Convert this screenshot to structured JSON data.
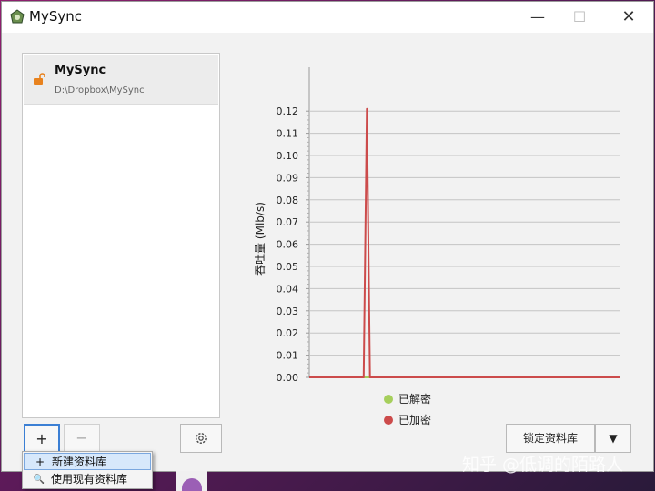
{
  "window": {
    "title": "MySync",
    "controls": {
      "minimize": "—",
      "maximize": "☐",
      "close": "✕"
    }
  },
  "libraries": [
    {
      "name": "MySync",
      "path": "D:\\Dropbox\\MySync",
      "icon": "unlocked-lock-icon"
    }
  ],
  "toolbar": {
    "add_label": "+",
    "remove_label": "−",
    "settings_icon": "gear-icon",
    "lock_label": "锁定资料库",
    "dropdown_label": "▼"
  },
  "add_menu": {
    "items": [
      {
        "icon": "+",
        "label": "新建资料库"
      },
      {
        "icon": "🔍",
        "label": "使用现有资料库"
      }
    ]
  },
  "legend": [
    {
      "label": "已解密",
      "color": "#a6cf5c"
    },
    {
      "label": "已加密",
      "color": "#cc4b4b"
    }
  ],
  "chart_data": {
    "type": "line",
    "ylabel": "吞吐量 (Mib/s)",
    "xlabel": "",
    "ylim": [
      0,
      0.125
    ],
    "yticks": [
      "0.00",
      "0.01",
      "0.02",
      "0.03",
      "0.04",
      "0.05",
      "0.06",
      "0.07",
      "0.08",
      "0.09",
      "0.10",
      "0.11",
      "0.12"
    ],
    "xlim": [
      0,
      100
    ],
    "grid": true,
    "series": [
      {
        "name": "已解密",
        "color": "#a6cf5c",
        "x": [
          0,
          100
        ],
        "y": [
          0,
          0
        ]
      },
      {
        "name": "已加密",
        "color": "#cc4b4b",
        "x": [
          0,
          17.5,
          18.5,
          19.5,
          100
        ],
        "y": [
          0,
          0,
          0.121,
          0,
          0
        ]
      }
    ]
  },
  "watermark": "知乎 @低调的陌路人"
}
